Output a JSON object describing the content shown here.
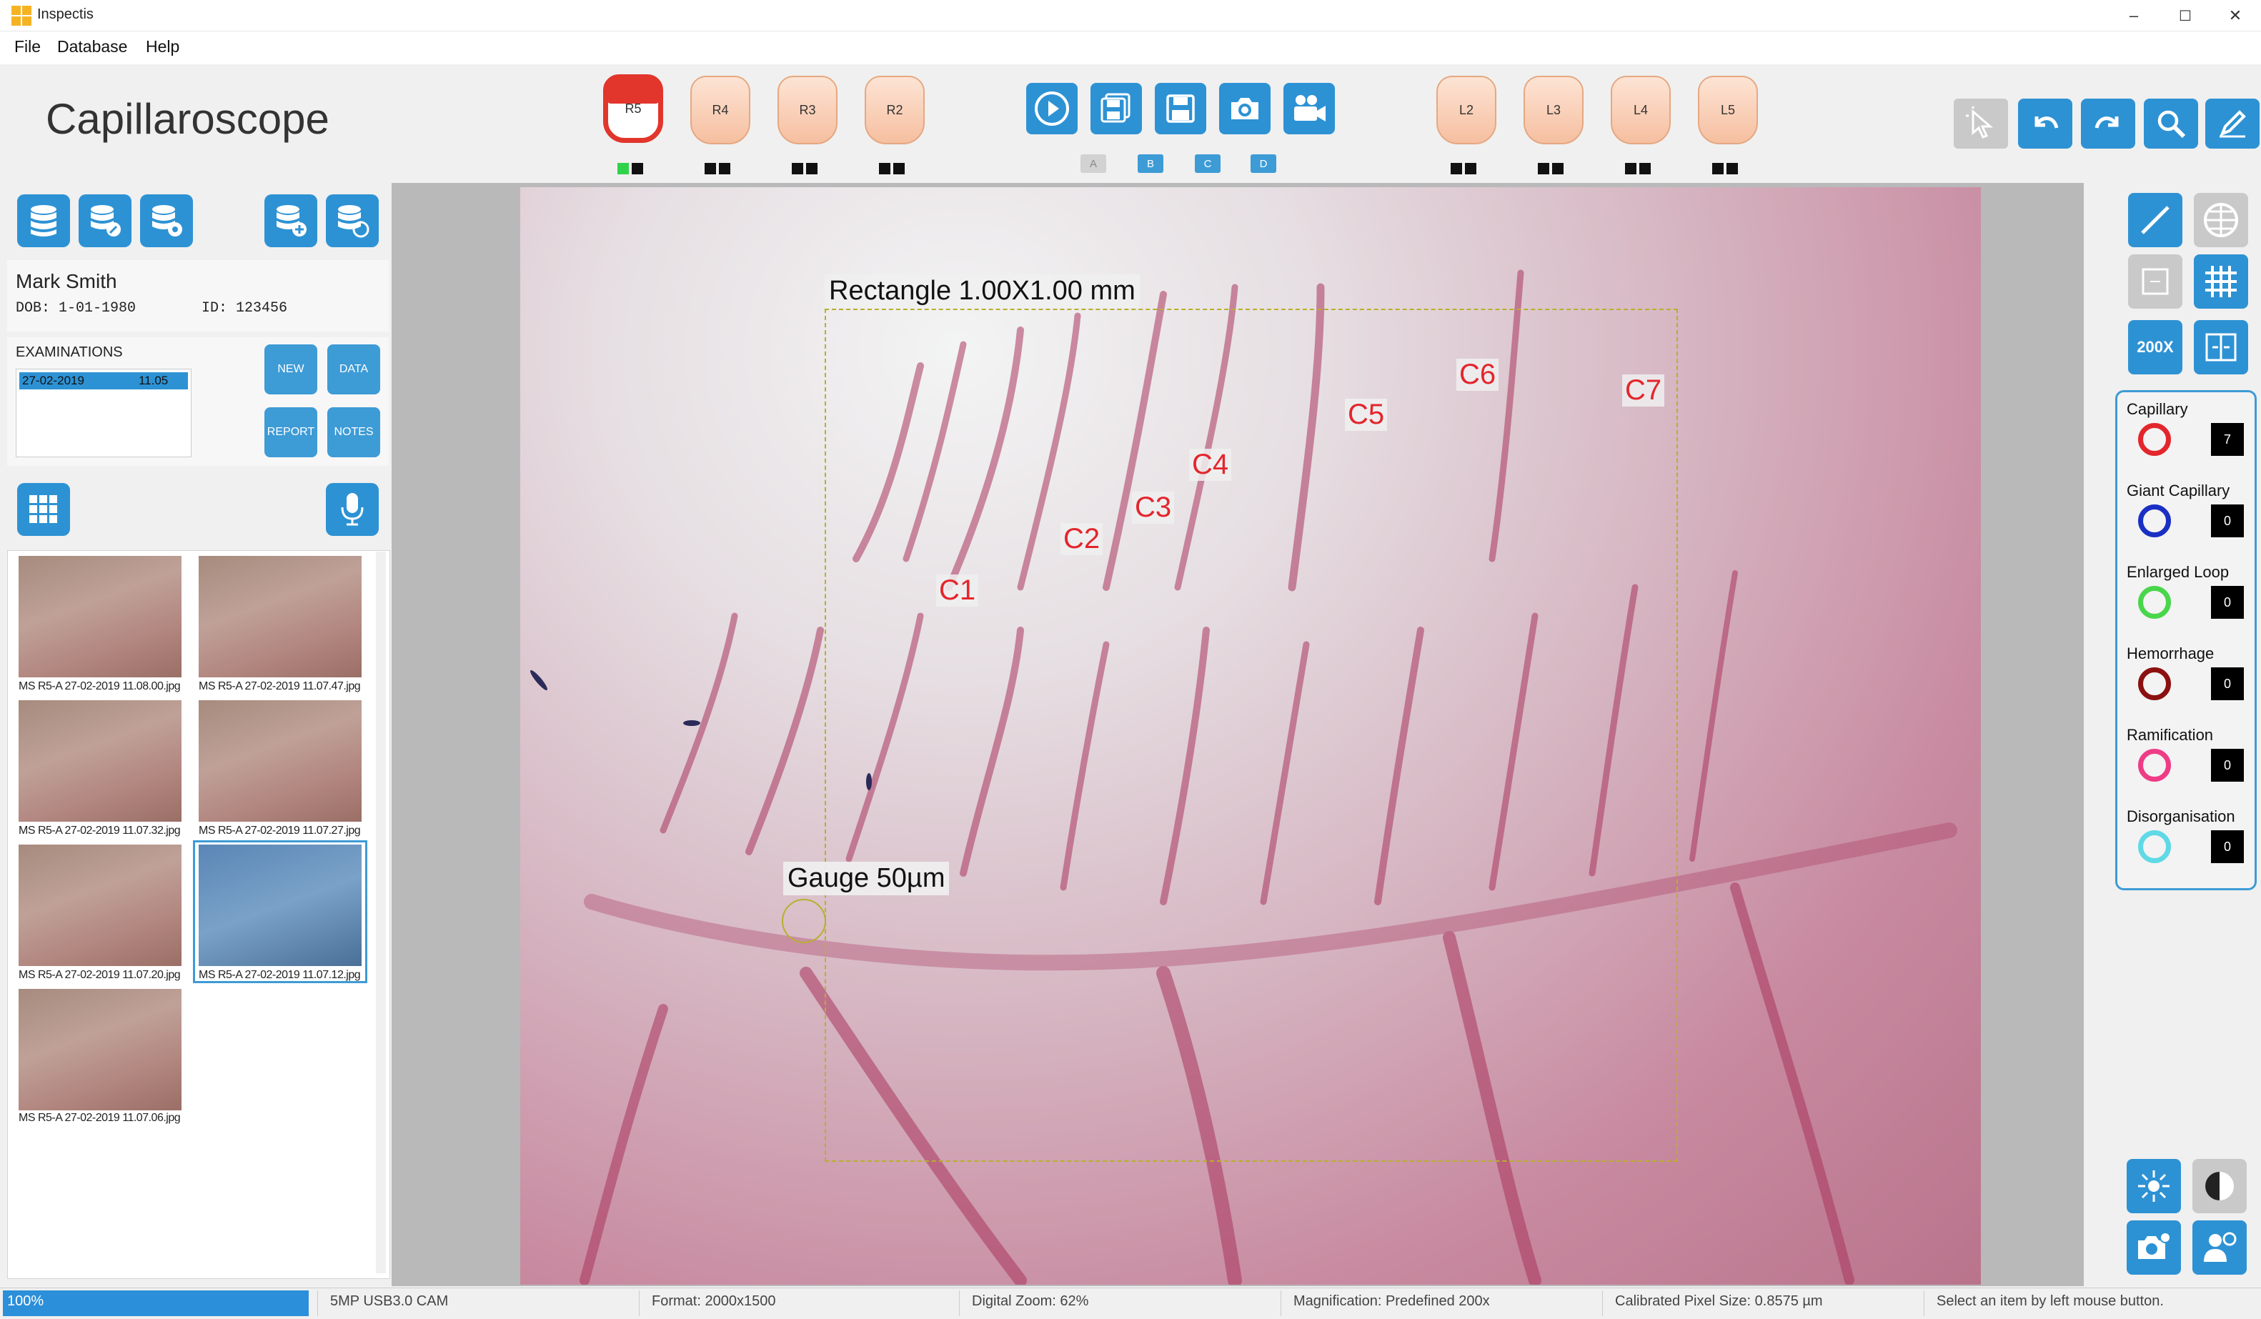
{
  "window": {
    "title": "Inspectis",
    "minimize": "–",
    "maximize": "☐",
    "close": "✕"
  },
  "menu": [
    "File",
    "Database",
    "Help"
  ],
  "app_heading": "Capillaroscope",
  "fingers_right": [
    {
      "label": "R5",
      "active": true
    },
    {
      "label": "R4",
      "active": false
    },
    {
      "label": "R3",
      "active": false
    },
    {
      "label": "R2",
      "active": false
    }
  ],
  "fingers_left": [
    {
      "label": "L2"
    },
    {
      "label": "L3"
    },
    {
      "label": "L4"
    },
    {
      "label": "L5"
    }
  ],
  "capture_letters": [
    "A",
    "B",
    "C",
    "D"
  ],
  "patient": {
    "name": "Mark Smith",
    "dob": "DOB: 1-01-1980",
    "id": "ID: 123456"
  },
  "examinations": {
    "title": "EXAMINATIONS",
    "selected_date": "27-02-2019",
    "selected_time": "11.05",
    "buttons": {
      "new": "NEW",
      "data": "DATA",
      "report": "REPORT",
      "notes": "NOTES"
    }
  },
  "thumbnails": [
    {
      "caption": "MS R5-A 27-02-2019 11.08.00.jpg"
    },
    {
      "caption": "MS R5-A 27-02-2019 11.07.47.jpg"
    },
    {
      "caption": "MS R5-A 27-02-2019 11.07.32.jpg"
    },
    {
      "caption": "MS R5-A 27-02-2019 11.07.27.jpg"
    },
    {
      "caption": "MS R5-A 27-02-2019 11.07.20.jpg"
    },
    {
      "caption": "MS R5-A 27-02-2019 11.07.12.jpg",
      "selected": true
    },
    {
      "caption": "MS R5-A 27-02-2019 11.07.06.jpg"
    }
  ],
  "overlay": {
    "rectangle_label": "Rectangle 1.00X1.00 mm",
    "gauge_label": "Gauge 50µm",
    "capillary_labels": [
      "C1",
      "C2",
      "C3",
      "C4",
      "C5",
      "C6",
      "C7"
    ]
  },
  "magnification_button": "200X",
  "counters": [
    {
      "label": "Capillary",
      "count": "7",
      "color": "#e3262c"
    },
    {
      "label": "Giant Capillary",
      "count": "0",
      "color": "#1a2fc4"
    },
    {
      "label": "Enlarged Loop",
      "count": "0",
      "color": "#49d64b"
    },
    {
      "label": "Hemorrhage",
      "count": "0",
      "color": "#8c1010"
    },
    {
      "label": "Ramification",
      "count": "0",
      "color": "#ef3c86"
    },
    {
      "label": "Disorganisation",
      "count": "0",
      "color": "#5fd9e6"
    }
  ],
  "status": {
    "progress": "100%",
    "camera": "5MP USB3.0 CAM",
    "format": "Format: 2000x1500",
    "zoom": "Digital Zoom: 62%",
    "magnification": "Magnification: Predefined 200x",
    "pixel_size": "Calibrated Pixel Size: 0.8575 µm",
    "hint": "Select an item by left mouse button."
  },
  "colors": {
    "accent": "#2d92d4",
    "active_finger": "#e2352c",
    "label_red": "#e3262c"
  },
  "icons": [
    "database-icon",
    "play-icon",
    "camera-icon",
    "video-camera-icon",
    "microphone-icon",
    "grid-icon",
    "pointer-icon",
    "undo-icon",
    "redo-icon",
    "search-icon",
    "pen-icon",
    "line-icon",
    "globe-icon",
    "brightness-icon",
    "contrast-icon"
  ]
}
